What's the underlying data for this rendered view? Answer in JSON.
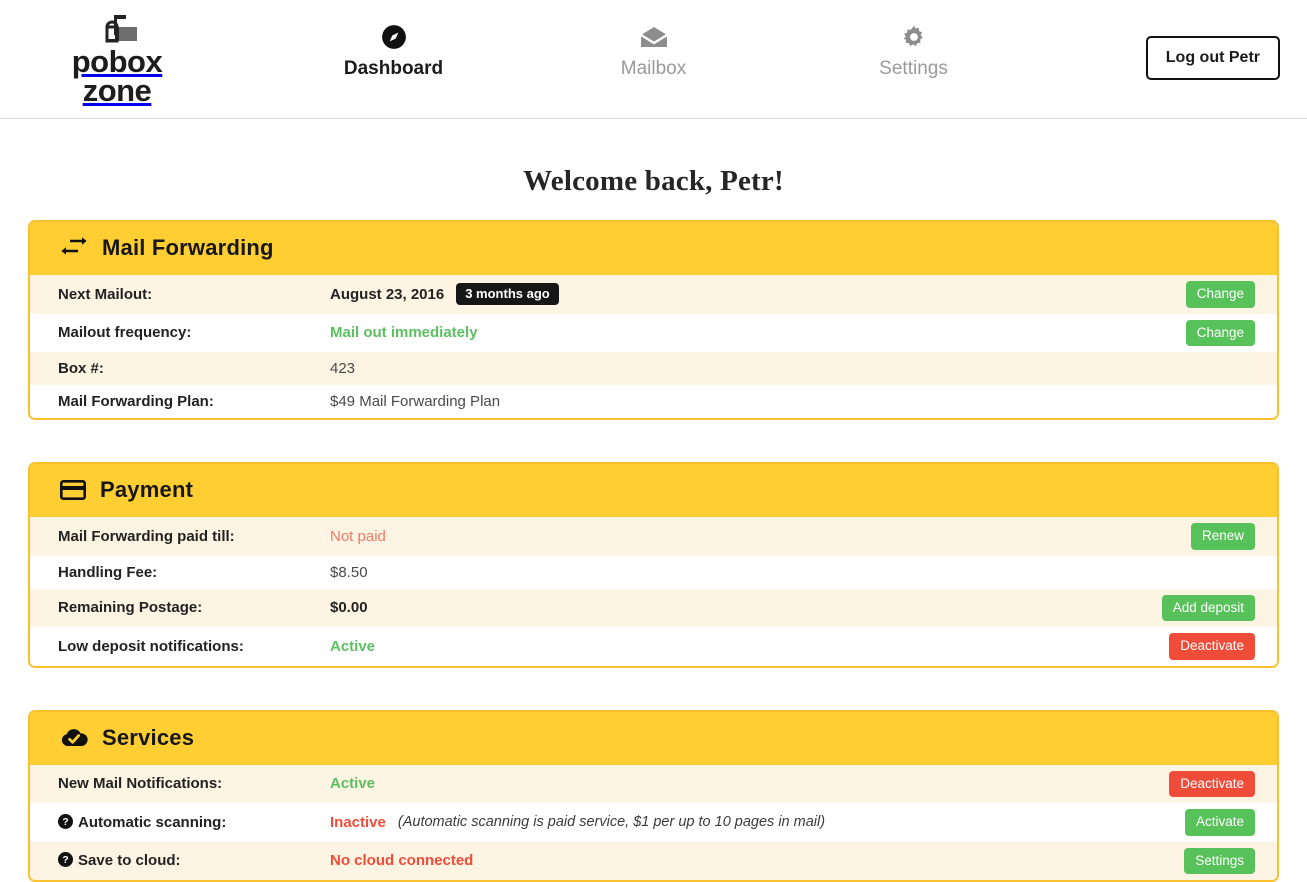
{
  "brand": {
    "line1": "pobox",
    "line2": "zone",
    "logo_icon": "mailbox-icon"
  },
  "nav": {
    "items": [
      {
        "label": "Dashboard",
        "icon": "compass-icon",
        "active": true
      },
      {
        "label": "Mailbox",
        "icon": "envelope-open-icon",
        "active": false
      },
      {
        "label": "Settings",
        "icon": "gear-icon",
        "active": false
      }
    ],
    "logout_label": "Log out Petr"
  },
  "page": {
    "title": "Welcome back, Petr!"
  },
  "colors": {
    "header_gold": "#FECE33",
    "panel_border": "#FBC02D",
    "row_cream": "#FDF4E3",
    "green": "#57C25A",
    "red": "#EF4C39",
    "badge_dark": "#161616"
  },
  "panels": [
    {
      "title": "Mail Forwarding",
      "icon": "exchange-arrows-icon",
      "rows": [
        {
          "label": "Next Mailout:",
          "label_icon": null,
          "value": "August 23, 2016",
          "value_style": "bold",
          "badge": "3 months ago",
          "note": null,
          "button": {
            "label": "Change",
            "style": "green"
          }
        },
        {
          "label": "Mailout frequency:",
          "label_icon": null,
          "value": "Mail out immediately",
          "value_style": "green",
          "badge": null,
          "note": null,
          "button": {
            "label": "Change",
            "style": "green"
          }
        },
        {
          "label": "Box #:",
          "label_icon": null,
          "value": "423",
          "value_style": "plain",
          "badge": null,
          "note": null,
          "button": null
        },
        {
          "label": "Mail Forwarding Plan:",
          "label_icon": null,
          "value": "$49 Mail Forwarding Plan",
          "value_style": "plain",
          "badge": null,
          "note": null,
          "button": null
        }
      ]
    },
    {
      "title": "Payment",
      "icon": "credit-card-icon",
      "rows": [
        {
          "label": "Mail Forwarding paid till:",
          "label_icon": null,
          "value": "Not paid",
          "value_style": "muted-red",
          "badge": null,
          "note": null,
          "button": {
            "label": "Renew",
            "style": "green"
          }
        },
        {
          "label": "Handling Fee:",
          "label_icon": null,
          "value": "$8.50",
          "value_style": "plain",
          "badge": null,
          "note": null,
          "button": null
        },
        {
          "label": "Remaining Postage:",
          "label_icon": null,
          "value": "$0.00",
          "value_style": "bold",
          "badge": null,
          "note": null,
          "button": {
            "label": "Add deposit",
            "style": "green"
          }
        },
        {
          "label": "Low deposit notifications:",
          "label_icon": null,
          "value": "Active",
          "value_style": "green",
          "badge": null,
          "note": null,
          "button": {
            "label": "Deactivate",
            "style": "red"
          }
        }
      ]
    },
    {
      "title": "Services",
      "icon": "cloud-check-icon",
      "rows": [
        {
          "label": "New Mail Notifications:",
          "label_icon": null,
          "value": "Active",
          "value_style": "green",
          "badge": null,
          "note": null,
          "button": {
            "label": "Deactivate",
            "style": "red"
          }
        },
        {
          "label": "Automatic scanning:",
          "label_icon": "question-circle-icon",
          "value": "Inactive",
          "value_style": "red",
          "badge": null,
          "note": "(Automatic scanning is paid service, $1 per up to 10 pages in mail)",
          "button": {
            "label": "Activate",
            "style": "green"
          }
        },
        {
          "label": "Save to cloud:",
          "label_icon": "question-circle-icon",
          "value": "No cloud connected",
          "value_style": "red",
          "badge": null,
          "note": null,
          "button": {
            "label": "Settings",
            "style": "green"
          }
        }
      ]
    }
  ]
}
